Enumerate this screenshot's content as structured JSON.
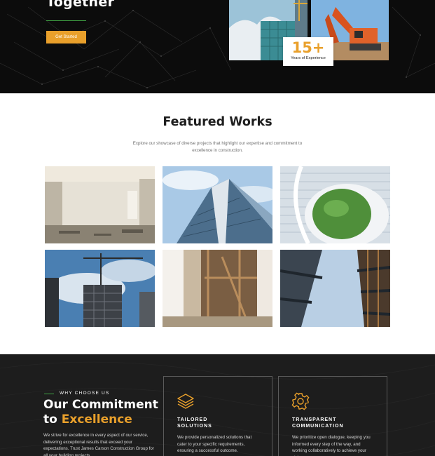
{
  "hero": {
    "title": "Together",
    "cta_label": "Get Started",
    "experience": {
      "number": "15+",
      "label": "Years of Experience"
    }
  },
  "featured": {
    "title": "Featured Works",
    "description": "Explore our showcase of diverse projects that highlight our expertise and commitment to excellence in construction."
  },
  "why": {
    "eyebrow": "WHY CHOOSE US",
    "heading_line1": "Our Commitment",
    "heading_line2_prefix": "to ",
    "heading_line2_accent": "Excellence",
    "description": "We strive for excellence in every aspect of our service, delivering exceptional results that exceed your expectations. Trust James Carson Construction Group for all your building projects.",
    "features": [
      {
        "icon": "layers-icon",
        "title_line1": "TAILORED",
        "title_line2": "SOLUTIONS",
        "description": "We provide personalized solutions that cater to your specific requirements, ensuring a successful outcome."
      },
      {
        "icon": "gear-icon",
        "title_line1": "TRANSPARENT",
        "title_line2": "COMMUNICATION",
        "description": "We prioritize open dialogue, keeping you informed every step of the way, and working collaboratively to achieve your vision."
      }
    ]
  },
  "colors": {
    "accent": "#e9a02b",
    "green": "#3fa143",
    "dark": "#0c0c0c",
    "panel": "#1d1d1d"
  }
}
